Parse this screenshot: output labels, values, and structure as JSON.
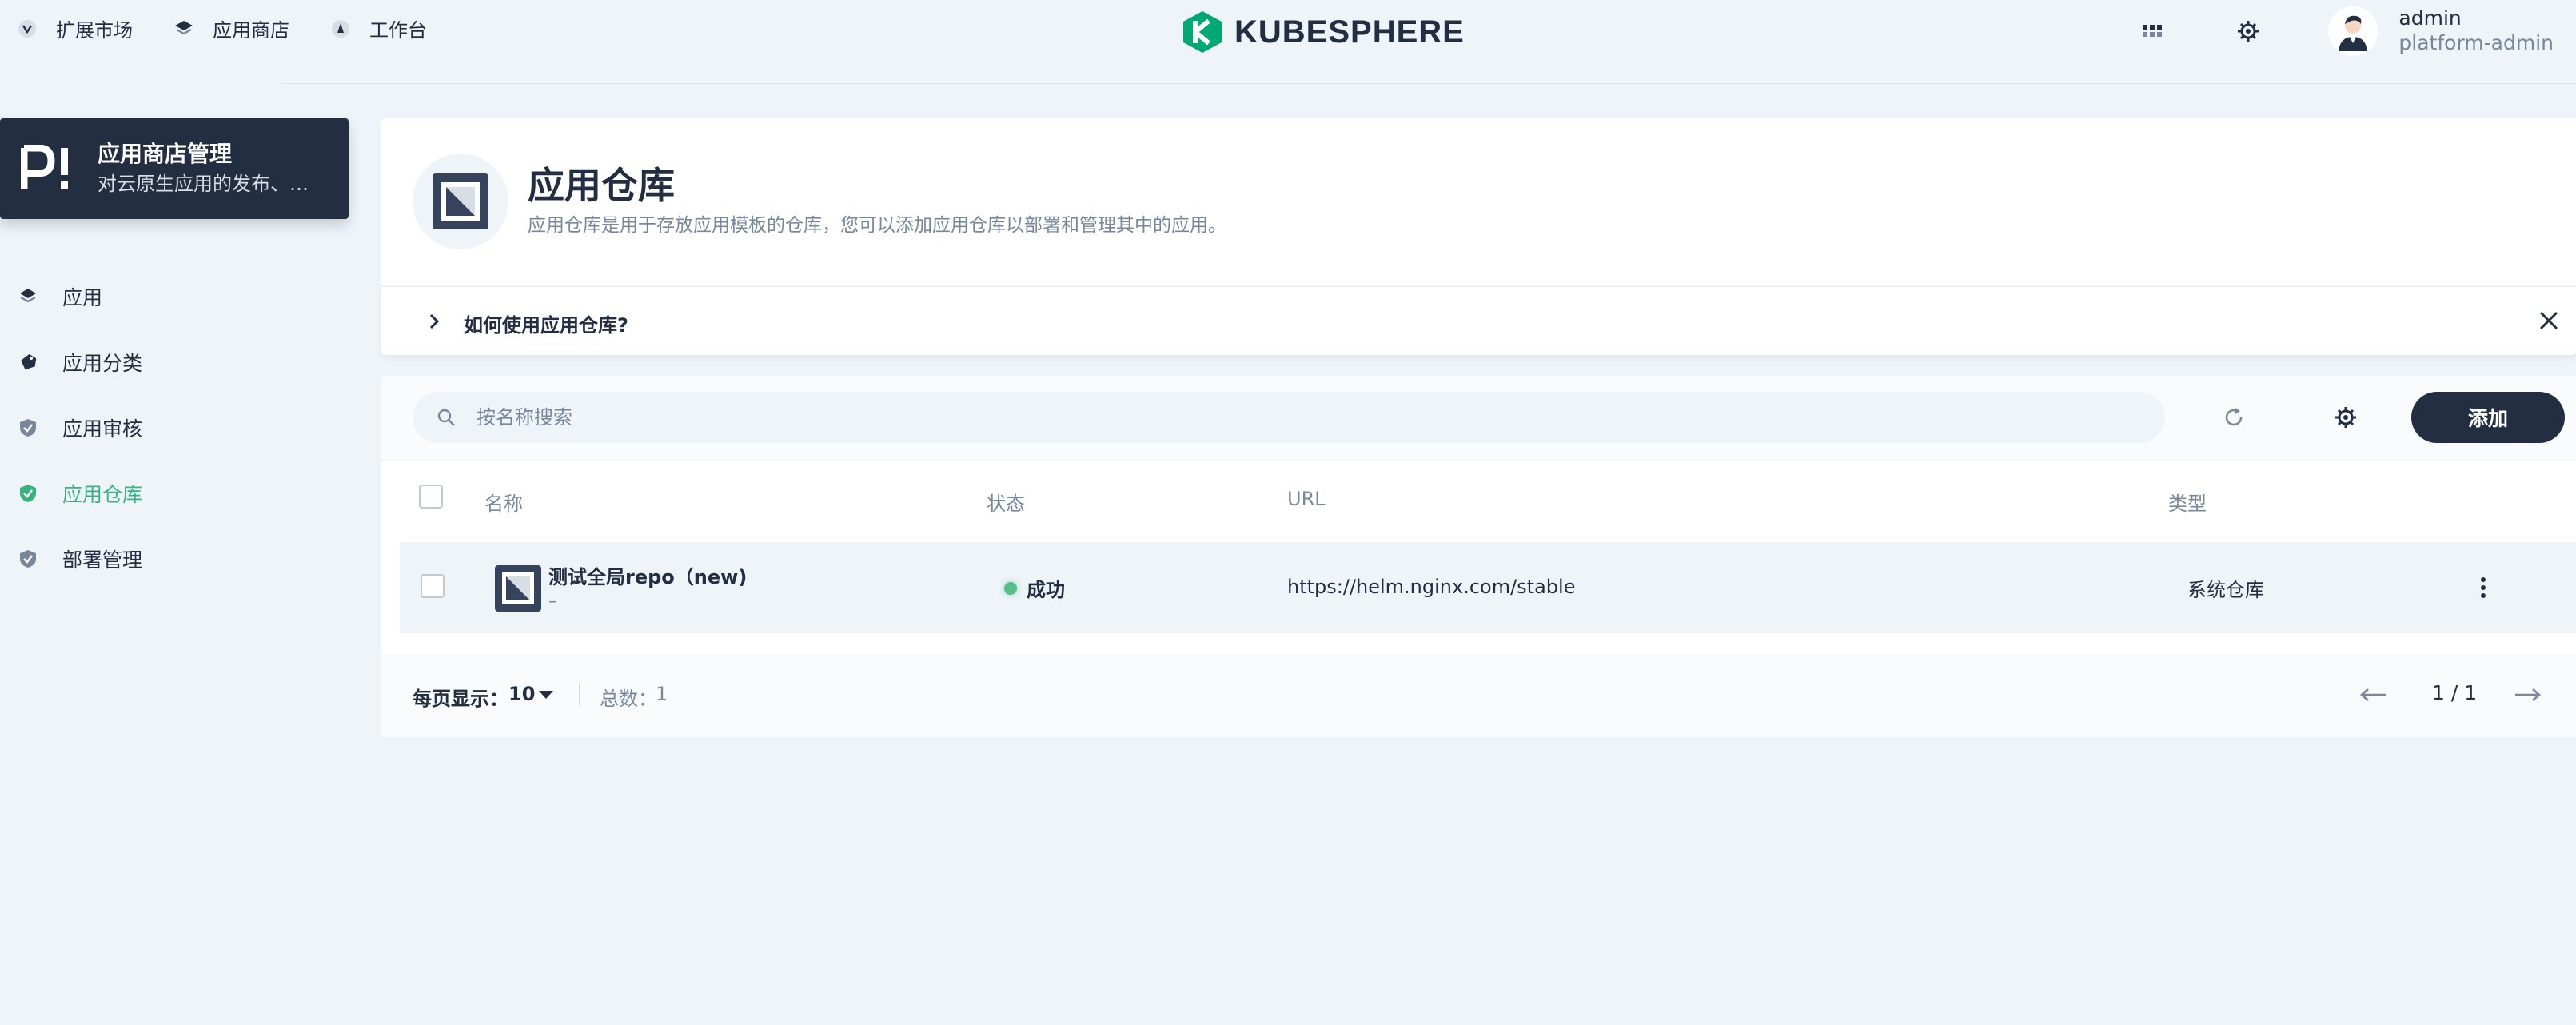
{
  "topnav": {
    "items": [
      {
        "label": "扩展市场",
        "icon": "extension-market-icon"
      },
      {
        "label": "应用商店",
        "icon": "app-store-icon"
      },
      {
        "label": "工作台",
        "icon": "workbench-icon"
      }
    ]
  },
  "logo": {
    "text": "KUBESPHERE",
    "color": "#00a971"
  },
  "user": {
    "name": "admin",
    "role": "platform-admin"
  },
  "sidebar": {
    "card": {
      "title": "应用商店管理",
      "description": "对云原生应用的发布、…"
    },
    "items": [
      {
        "label": "应用",
        "icon": "app-icon",
        "active": false
      },
      {
        "label": "应用分类",
        "icon": "tag-icon",
        "active": false
      },
      {
        "label": "应用审核",
        "icon": "review-shield-icon",
        "active": false
      },
      {
        "label": "应用仓库",
        "icon": "repo-shield-icon",
        "active": true
      },
      {
        "label": "部署管理",
        "icon": "deploy-shield-icon",
        "active": false
      }
    ]
  },
  "banner": {
    "title": "应用仓库",
    "description": "应用仓库是用于存放应用模板的仓库，您可以添加应用仓库以部署和管理其中的应用。"
  },
  "howto": {
    "label": "如何使用应用仓库?"
  },
  "toolbar": {
    "search_placeholder": "按名称搜索",
    "add_label": "添加"
  },
  "table": {
    "columns": [
      "名称",
      "状态",
      "URL",
      "类型"
    ],
    "rows": [
      {
        "name": "测试全局repo（new)",
        "subtitle": "–",
        "status": "成功",
        "url": "https://helm.nginx.com/stable",
        "type": "系统仓库"
      }
    ]
  },
  "pagination": {
    "per_page_label": "每页显示：",
    "per_page": "10",
    "total_label": "总数：",
    "total": "1",
    "page": "1 / 1"
  },
  "colors": {
    "accent": "#36b37e",
    "dark": "#242e42",
    "muted": "#79879c",
    "background": "#eff4f9"
  }
}
